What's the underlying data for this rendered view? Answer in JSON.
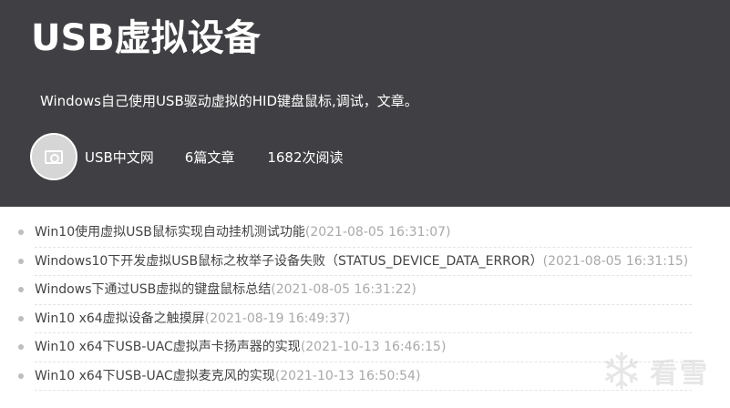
{
  "header": {
    "title": "USB虚拟设备",
    "description": "Windows自己使用USB驱动虚拟的HID键盘鼠标,调试，文章。",
    "author": "USB中文网",
    "article_count": "6篇文章",
    "read_count": "1682次阅读"
  },
  "articles": [
    {
      "title": "Win10使用虚拟USB鼠标实现自动挂机测试功能",
      "date": "(2021-08-05 16:31:07)"
    },
    {
      "title": "Windows10下开发虚拟USB鼠标之枚举子设备失败（STATUS_DEVICE_DATA_ERROR）",
      "date": "(2021-08-05 16:31:15)"
    },
    {
      "title": "Windows下通过USB虚拟的键盘鼠标总结",
      "date": "(2021-08-05 16:31:22)"
    },
    {
      "title": "Win10 x64虚拟设备之触摸屏",
      "date": "(2021-08-19 16:49:37)"
    },
    {
      "title": "Win10 x64下USB-UAC虚拟声卡扬声器的实现",
      "date": "(2021-10-13 16:46:15)"
    },
    {
      "title": "Win10 x64下USB-UAC虚拟麦克风的实现",
      "date": "(2021-10-13 16:50:54)"
    }
  ],
  "watermark": {
    "text": "看雪",
    "icon": "snowflake-icon"
  },
  "colors": {
    "header_bg": "#404044",
    "date_text": "#a9a9a9",
    "title_text": "#444444"
  }
}
